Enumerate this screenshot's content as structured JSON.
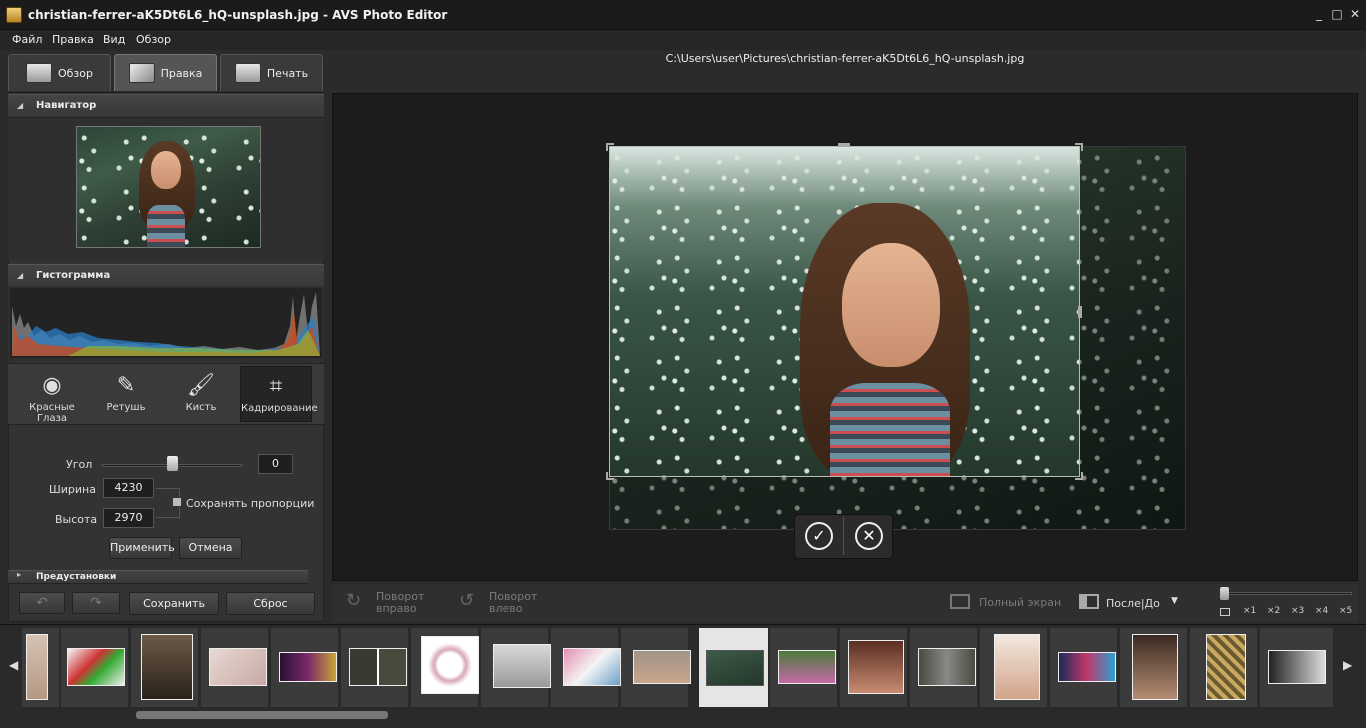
{
  "window": {
    "title": "christian-ferrer-aK5Dt6L6_hQ-unsplash.jpg - AVS Photo Editor",
    "controls": [
      "_",
      "□",
      "✕"
    ]
  },
  "menu": [
    "Файл",
    "Правка",
    "Вид",
    "Обзор"
  ],
  "tabs": [
    {
      "label": "Обзор",
      "active": false
    },
    {
      "label": "Правка",
      "active": true
    },
    {
      "label": "Печать",
      "active": false
    }
  ],
  "file_path": "C:\\Users\\user\\Pictures\\christian-ferrer-aK5Dt6L6_hQ-unsplash.jpg",
  "panels": {
    "navigator": "Навигатор",
    "histogram": "Гистограмма",
    "presets": "Предустановки"
  },
  "tools": [
    {
      "label": "Красные Глаза",
      "icon": "eye-icon"
    },
    {
      "label": "Ретушь",
      "icon": "retouch-brush-icon"
    },
    {
      "label": "Кисть",
      "icon": "paint-brush-icon"
    },
    {
      "label": "Кадрирование",
      "icon": "crop-icon",
      "active": true
    }
  ],
  "crop": {
    "angle_label": "Угол",
    "angle_value": "0",
    "width_label": "Ширина",
    "width_value": "4230",
    "height_label": "Высота",
    "height_value": "2970",
    "keep_ratio_label": "Сохранять пропорции",
    "keep_ratio_checked": false,
    "apply_label": "Применить",
    "cancel_label": "Отмена"
  },
  "footer": {
    "save_label": "Сохранить",
    "reset_label": "Сброс"
  },
  "bottombar": {
    "rotate_right": "Поворот вправо",
    "rotate_left": "Поворот влево",
    "fullscreen": "Полный экран",
    "before_after": "После|До",
    "zoom_labels": [
      "×1",
      "×2",
      "×3",
      "×4",
      "×5"
    ]
  },
  "colors": {
    "accent": "#e8e8e8",
    "panel": "#333333",
    "canvas": "#1c1c1c"
  }
}
